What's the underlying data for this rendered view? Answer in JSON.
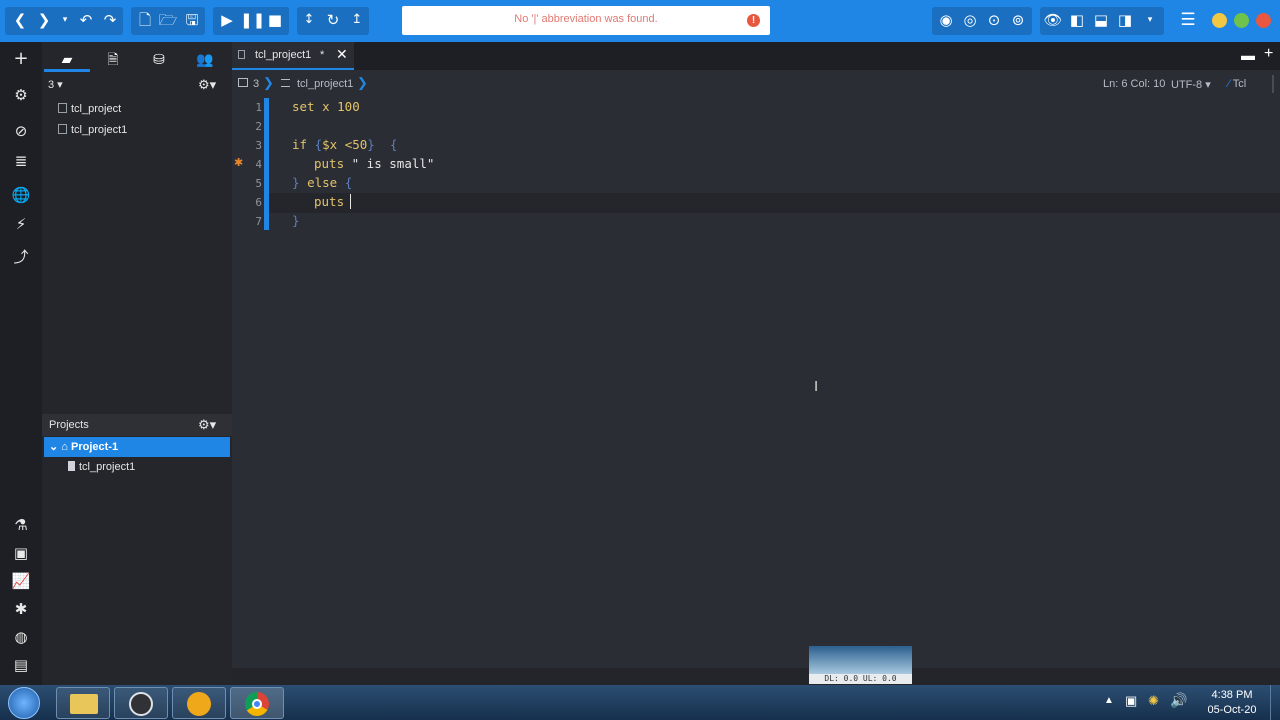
{
  "notification": {
    "message": "No '|' abbreviation was found.",
    "icon": "!"
  },
  "sidepanel": {
    "filter_label": "3",
    "files": [
      "tcl_project",
      "tcl_project1"
    ],
    "projects_title": "Projects",
    "project_name": "Project-1",
    "project_files": [
      "tcl_project1"
    ]
  },
  "editor": {
    "tab_title": "tcl_project1",
    "tab_modified": "*",
    "breadcrumb_num": "3",
    "breadcrumb_file": "tcl_project1",
    "position": "Ln: 6 Col: 10",
    "encoding": "UTF-8",
    "language": "Tcl",
    "line_numbers": [
      "1",
      "2",
      "3",
      "4",
      "5",
      "6",
      "7"
    ]
  },
  "code": {
    "l1_kw": "set",
    "l1_rest": " x 100",
    "l3_kw": "if",
    "l3_brace_open": " {",
    "l3_expr": "$x <50",
    "l3_brace_close": "}  {",
    "l4_kw": "puts",
    "l4_str": " \" is small\"",
    "l5_close": "} ",
    "l5_kw": "else",
    "l5_open": " {",
    "l6_kw": "puts",
    "l6_rest": " ",
    "l7_close": "}"
  },
  "net_widget": {
    "label": "DL: 0.0  UL: 0.0"
  },
  "taskbar": {
    "time": "4:38 PM",
    "date": "05-Oct-20"
  },
  "colors": {
    "accent": "#1f86e6",
    "editor_bg": "#2b2d34",
    "keyword": "#e2c36a"
  }
}
